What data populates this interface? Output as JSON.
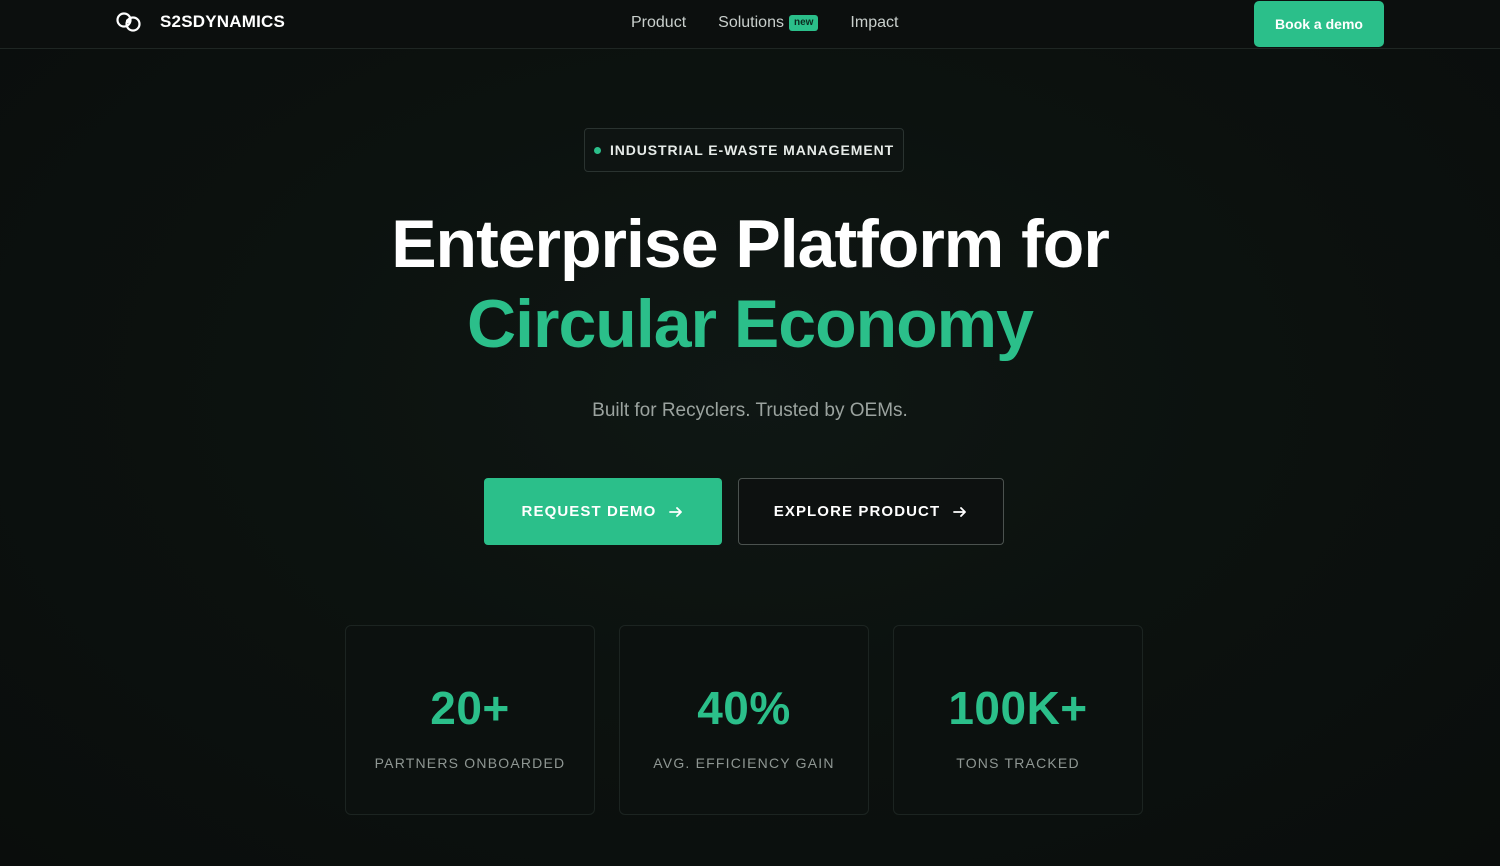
{
  "brand": {
    "name": "S2SDYNAMICS",
    "icon": "link-rings-logo"
  },
  "nav": {
    "links": [
      {
        "label": "Product"
      },
      {
        "label": "Solutions",
        "badge": "new"
      },
      {
        "label": "Impact"
      }
    ],
    "cta_label": "Book a demo"
  },
  "hero": {
    "tag": "INDUSTRIAL E-WASTE MANAGEMENT",
    "title_line1": "Enterprise Platform for",
    "title_line2": "Circular Economy",
    "subtitle": "Built for Recyclers. Trusted by OEMs.",
    "primary_cta": "REQUEST DEMO",
    "secondary_cta": "EXPLORE PRODUCT"
  },
  "stats": [
    {
      "value": "20+",
      "label": "PARTNERS ONBOARDED"
    },
    {
      "value": "40%",
      "label": "AVG. EFFICIENCY GAIN"
    },
    {
      "value": "100K+",
      "label": "TONS TRACKED"
    }
  ],
  "colors": {
    "accent": "#2bbf8a",
    "background": "#0b0f0d",
    "muted_text": "#9ba39f"
  }
}
